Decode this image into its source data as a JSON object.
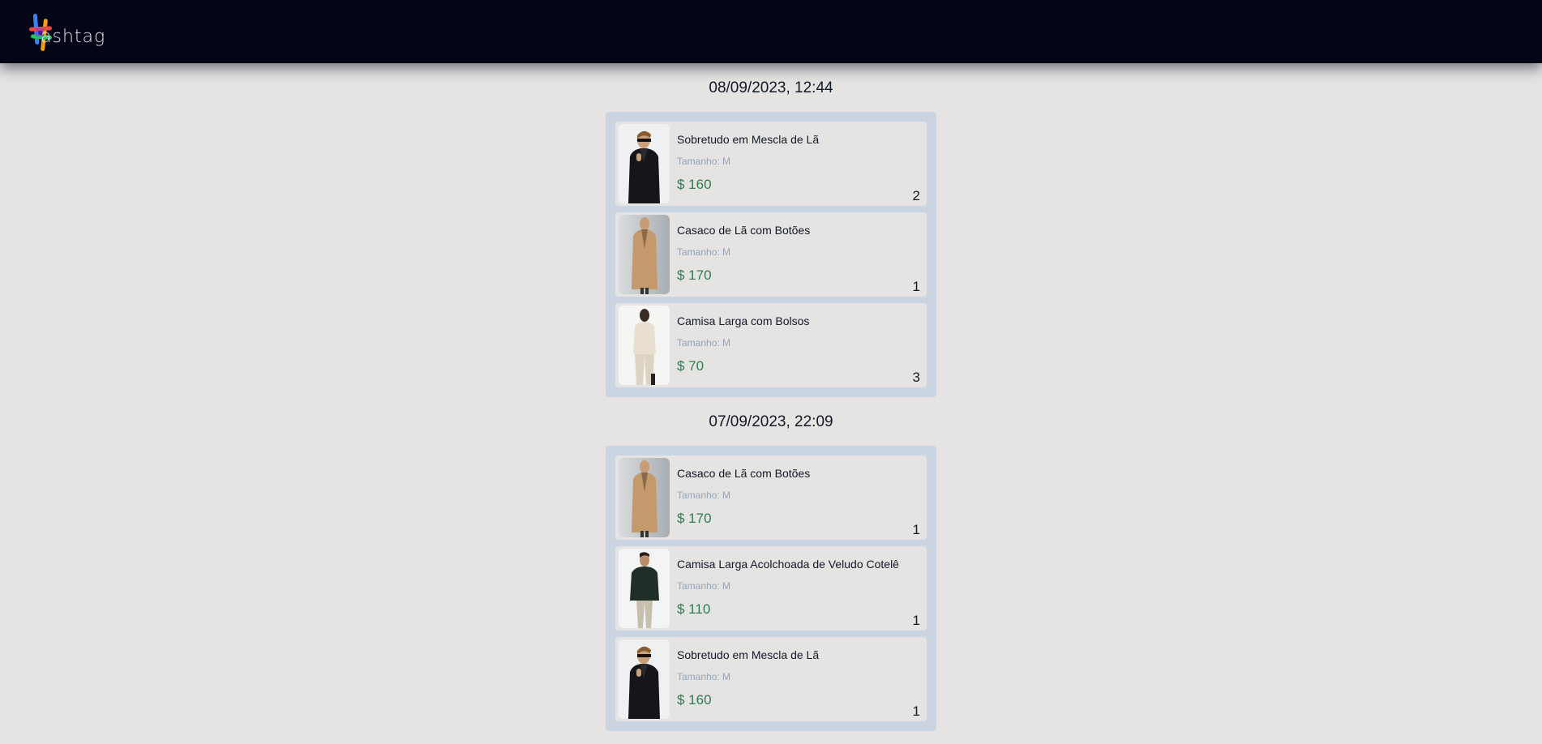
{
  "header": {
    "logo_text": "ashtag"
  },
  "orders": [
    {
      "date": "08/09/2023, 12:44",
      "items": [
        {
          "name": "Sobretudo em Mescla de Lã",
          "size": "Tamanho: M",
          "price": "$ 160",
          "qty": "2",
          "image": "black-coat-photo"
        },
        {
          "name": "Casaco de Lã com Botões",
          "size": "Tamanho: M",
          "price": "$ 170",
          "qty": "1",
          "image": "camel-coat-photo"
        },
        {
          "name": "Camisa Larga com Bolsos",
          "size": "Tamanho: M",
          "price": "$ 70",
          "qty": "3",
          "image": "cream-shirt-photo"
        }
      ]
    },
    {
      "date": "07/09/2023, 22:09",
      "items": [
        {
          "name": "Casaco de Lã com Botões",
          "size": "Tamanho: M",
          "price": "$ 170",
          "qty": "1",
          "image": "camel-coat-photo"
        },
        {
          "name": "Camisa Larga Acolchoada de Veludo Cotelê",
          "size": "Tamanho: M",
          "price": "$ 110",
          "qty": "1",
          "image": "green-corduroy-shirt-photo"
        },
        {
          "name": "Sobretudo em Mescla de Lã",
          "size": "Tamanho: M",
          "price": "$ 160",
          "qty": "1",
          "image": "black-coat-photo"
        }
      ]
    }
  ],
  "colors": {
    "header_bg": "#020617",
    "page_bg": "#e5e4e2",
    "order_bg": "#cbd5e1",
    "price": "#2e7d4f",
    "size_text": "#94a3b8"
  }
}
